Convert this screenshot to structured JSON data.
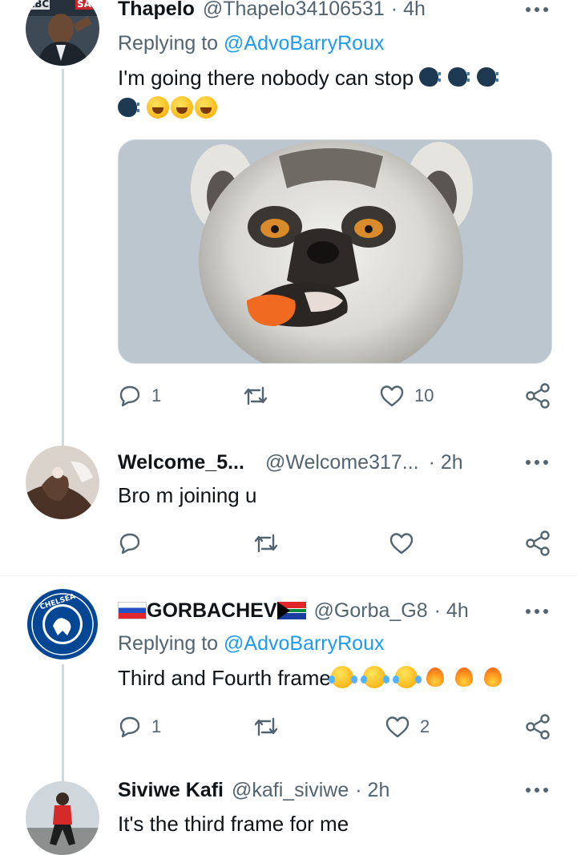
{
  "tweets": [
    {
      "name": "Thapelo",
      "handle": "@Thapelo34106531",
      "time": "· 4h",
      "replying_label": "Replying to",
      "replying_to": "@AdvoBarryRoux",
      "text": "I'm going there nobody can stop",
      "emojis": [
        "speaking-head-emoji",
        "rofl-emoji"
      ],
      "avatar_badges": [
        "ABC",
        "SAB"
      ],
      "media": "lemur-photo",
      "stats": {
        "replies": "1",
        "retweets": "",
        "likes": "10"
      }
    },
    {
      "name": "Welcome_5...",
      "handle": "@Welcome317...",
      "time": "· 2h",
      "text": "Bro m joining u",
      "stats": {
        "replies": "",
        "retweets": "",
        "likes": ""
      }
    },
    {
      "name": "GORBACHEV",
      "handle": "@Gorba_G8",
      "time": "· 4h",
      "replying_label": "Replying to",
      "replying_to": "@AdvoBarryRoux",
      "text": "Third and Fourth frame",
      "emojis": [
        "joy-emoji",
        "fire-emoji"
      ],
      "name_flags": [
        "russia-flag",
        "south-africa-flag"
      ],
      "avatar_badge_text": "CHELSEA",
      "stats": {
        "replies": "1",
        "retweets": "",
        "likes": "2"
      }
    },
    {
      "name": "Siviwe Kafi",
      "handle": "@kafi_siviwe",
      "time": "· 2h",
      "text": "It's the third frame for me"
    }
  ],
  "icons": {
    "reply": "reply-icon",
    "retweet": "retweet-icon",
    "like": "heart-icon",
    "share": "share-icon",
    "more": "more-icon"
  },
  "colors": {
    "text": "#0f1419",
    "secondary": "#536471",
    "link": "#1d9bf0",
    "divider": "#eff3f4",
    "thread_line": "#cfd9de"
  }
}
